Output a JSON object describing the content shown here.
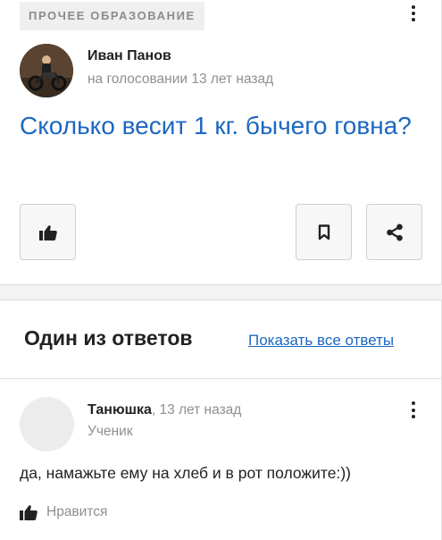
{
  "question": {
    "category": "ПРОЧЕЕ ОБРАЗОВАНИЕ",
    "author": "Иван Панов",
    "meta": "на голосовании 13 лет назад",
    "title": "Сколько весит 1 кг. бычего говна?"
  },
  "answers_section": {
    "heading": "Один из ответов",
    "show_all_label": "Показать все ответы"
  },
  "answer": {
    "author": "Танюшка",
    "time": ", 13 лет назад",
    "rank": "Ученик",
    "text": "да, намажьте ему на хлеб и в рот положите:))",
    "like_label": "Нравится"
  },
  "colors": {
    "link_blue": "#1d67c1",
    "muted_gray": "#8f8f8f"
  },
  "icons": [
    "kebab-menu-icon",
    "thumbs-up-icon",
    "bookmark-icon",
    "share-icon"
  ]
}
